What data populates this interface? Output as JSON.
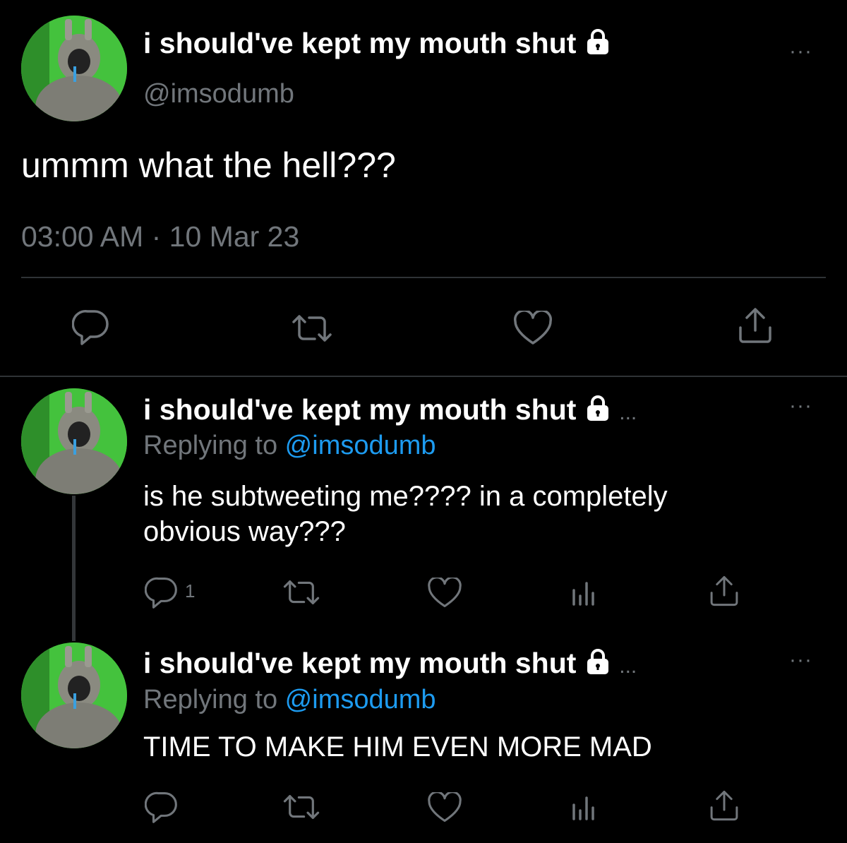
{
  "main_tweet": {
    "display_name": "i should've kept my mouth shut",
    "handle": "@imsodumb",
    "text": "ummm what the hell???",
    "timestamp": "03:00 AM · 10 Mar 23",
    "more": "···"
  },
  "replies": [
    {
      "display_name": "i should've kept my mouth shut",
      "ellipsis": "...",
      "replying_prefix": "Replying to ",
      "replying_handle": "@imsodumb",
      "text_line1": "is he subtweeting me???? in a completely",
      "text_line2": "obvious way???",
      "reply_count": "1",
      "more": "···"
    },
    {
      "display_name": "i should've kept my mouth shut",
      "ellipsis": "...",
      "replying_prefix": "Replying to ",
      "replying_handle": "@imsodumb",
      "text_line1": "TIME TO MAKE HIM EVEN MORE MAD",
      "more": "···"
    }
  ],
  "icons": [
    "reply-icon",
    "retweet-icon",
    "like-icon",
    "share-icon",
    "views-icon",
    "lock-icon",
    "more-icon"
  ],
  "colors": {
    "background": "#000000",
    "secondary": "#71767b",
    "link": "#1d9bf0",
    "divider": "#2f3336"
  }
}
